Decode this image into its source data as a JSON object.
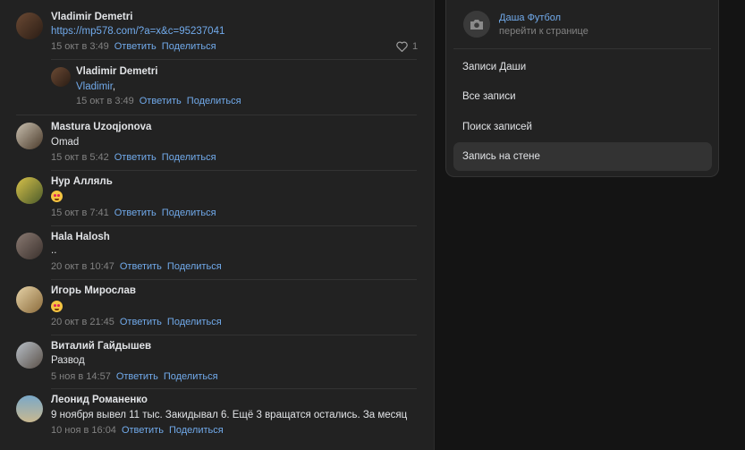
{
  "comments": [
    {
      "name": "Vladimir Demetri",
      "text_link": "https://mp578.com/?a=x&c=95237041",
      "date": "15 окт в 3:49",
      "reply": "Ответить",
      "share": "Поделиться",
      "likes": "1"
    },
    {
      "name": "Vladimir Demetri",
      "text_link": "Vladimir",
      "text_rest": ",",
      "date": "15 окт в 3:49",
      "reply": "Ответить",
      "share": "Поделиться"
    },
    {
      "name": "Mastura Uzoqjonova",
      "text": "Omad",
      "date": "15 окт в 5:42",
      "reply": "Ответить",
      "share": "Поделиться"
    },
    {
      "name": "Нур Алляль",
      "text": "",
      "date": "15 окт в 7:41",
      "reply": "Ответить",
      "share": "Поделиться"
    },
    {
      "name": "Hala Halosh",
      "text": "..",
      "date": "20 окт в 10:47",
      "reply": "Ответить",
      "share": "Поделиться"
    },
    {
      "name": "Игорь Мирослав",
      "text": "",
      "date": "20 окт в 21:45",
      "reply": "Ответить",
      "share": "Поделиться"
    },
    {
      "name": "Виталий Гайдышев",
      "text": "Развод",
      "date": "5 ноя в 14:57",
      "reply": "Ответить",
      "share": "Поделиться"
    },
    {
      "name": "Леонид Романенко",
      "text": "9 ноября вывел 11 тыс. Закидывал 6. Ещё 3 вращатся остались. За месяц",
      "date": "10 ноя в 16:04",
      "reply": "Ответить",
      "share": "Поделиться"
    }
  ],
  "menu": {
    "owner_name": "Даша Футбол",
    "owner_sub": "перейти к странице",
    "items": [
      {
        "label": "Записи Даши"
      },
      {
        "label": "Все записи"
      },
      {
        "label": "Поиск записей"
      },
      {
        "label": "Запись на стене",
        "active": true
      }
    ]
  },
  "colors": {
    "accent": "#71aaeb",
    "bg": "#222222",
    "muted": "#828282"
  }
}
